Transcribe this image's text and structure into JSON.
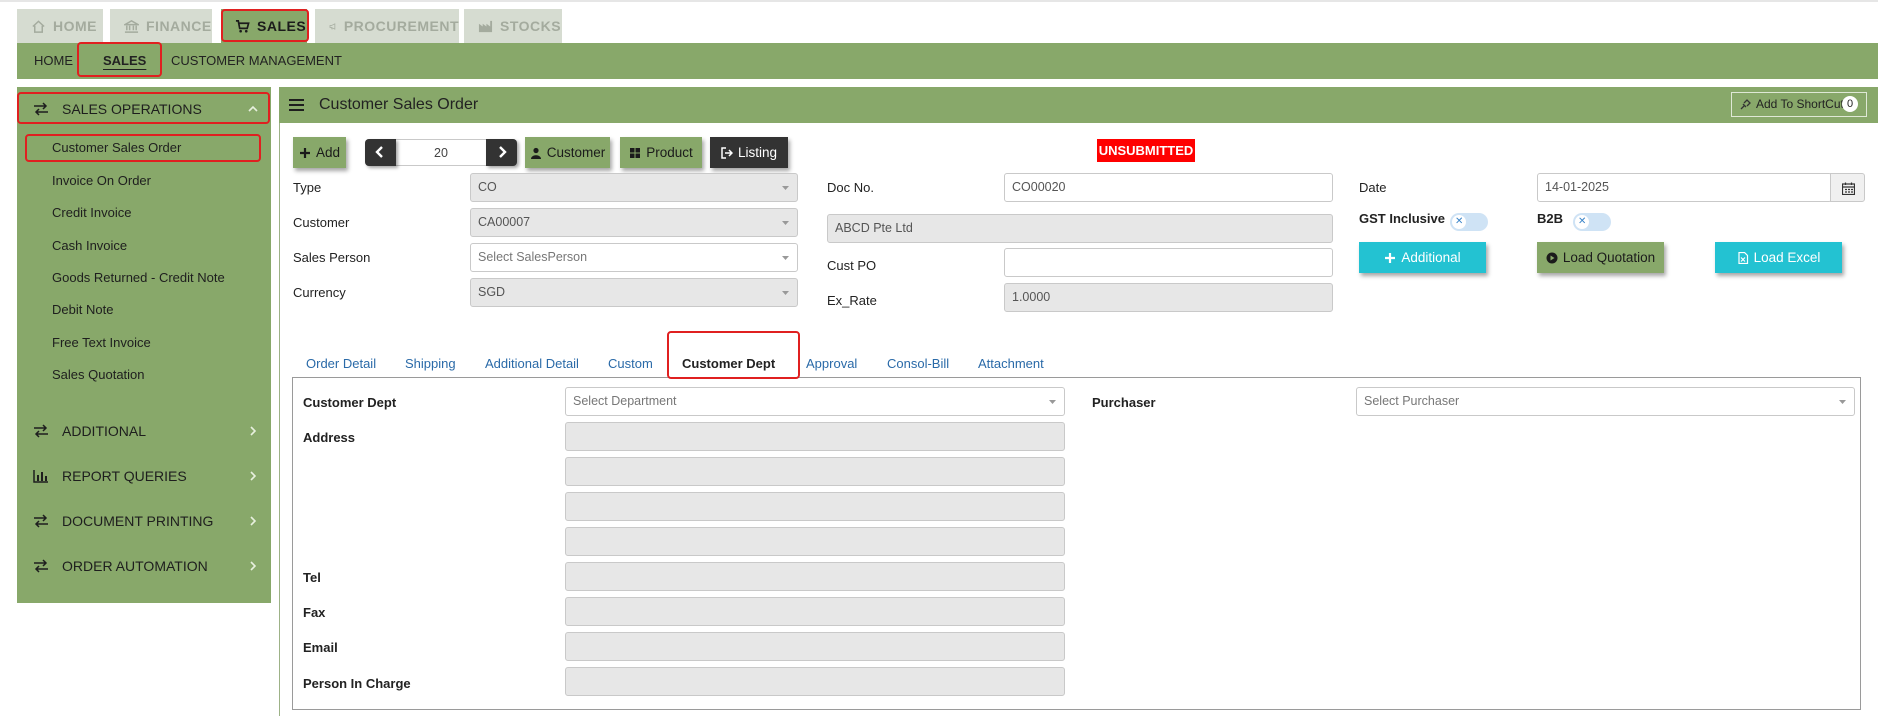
{
  "module_tabs": [
    {
      "label": "HOME",
      "icon": "home-icon"
    },
    {
      "label": "FINANCE",
      "icon": "bank-icon"
    },
    {
      "label": "SALES",
      "icon": "cart-icon",
      "active": true
    },
    {
      "label": "PROCUREMENT",
      "icon": "megaphone-icon"
    },
    {
      "label": "STOCKS",
      "icon": "factory-icon"
    }
  ],
  "sub_nav": {
    "home": "HOME",
    "sales": "SALES",
    "customer_management": "CUSTOMER MANAGEMENT"
  },
  "sidebar": {
    "sales_operations": "SALES OPERATIONS",
    "items": [
      "Customer Sales Order",
      "Invoice On Order",
      "Credit Invoice",
      "Cash Invoice",
      "Goods Returned - Credit Note",
      "Debit Note",
      "Free Text Invoice",
      "Sales Quotation"
    ],
    "additional": "ADDITIONAL",
    "report_queries": "REPORT QUERIES",
    "document_printing": "DOCUMENT PRINTING",
    "order_automation": "ORDER AUTOMATION"
  },
  "panel": {
    "title": "Customer Sales Order",
    "shortcut_label": "Add To ShortCut",
    "shortcut_count": "0"
  },
  "toolbar": {
    "add": "Add",
    "record_no": "20",
    "customer": "Customer",
    "product": "Product",
    "listing": "Listing"
  },
  "status_badge": "UNSUBMITTED",
  "header": {
    "type_label": "Type",
    "type_value": "CO",
    "customer_label": "Customer",
    "customer_value": "CA00007",
    "sales_person_label": "Sales Person",
    "sales_person_placeholder": "Select SalesPerson",
    "currency_label": "Currency",
    "currency_value": "SGD",
    "doc_no_label": "Doc No.",
    "doc_no_value": "CO00020",
    "customer_name": "ABCD Pte Ltd",
    "cust_po_label": "Cust PO",
    "cust_po_value": "",
    "ex_rate_label": "Ex_Rate",
    "ex_rate_value": "1.0000",
    "date_label": "Date",
    "date_value": "14-01-2025",
    "gst_inclusive_label": "GST Inclusive",
    "b2b_label": "B2B",
    "additional_button": "Additional",
    "load_quotation_button": "Load Quotation",
    "load_excel_button": "Load Excel"
  },
  "tabs": [
    "Order Detail",
    "Shipping",
    "Additional Detail",
    "Custom",
    "Customer Dept",
    "Approval",
    "Consol-Bill",
    "Attachment"
  ],
  "dept_panel": {
    "customer_dept_label": "Customer Dept",
    "department_placeholder": "Select Department",
    "purchaser_label": "Purchaser",
    "purchaser_placeholder": "Select Purchaser",
    "address_label": "Address",
    "tel_label": "Tel",
    "fax_label": "Fax",
    "email_label": "Email",
    "person_in_charge_label": "Person In Charge"
  },
  "colors": {
    "accent_green": "#88a86a",
    "status_red": "#ff0000",
    "teal": "#23c2d2",
    "highlight_red": "#e02020"
  }
}
